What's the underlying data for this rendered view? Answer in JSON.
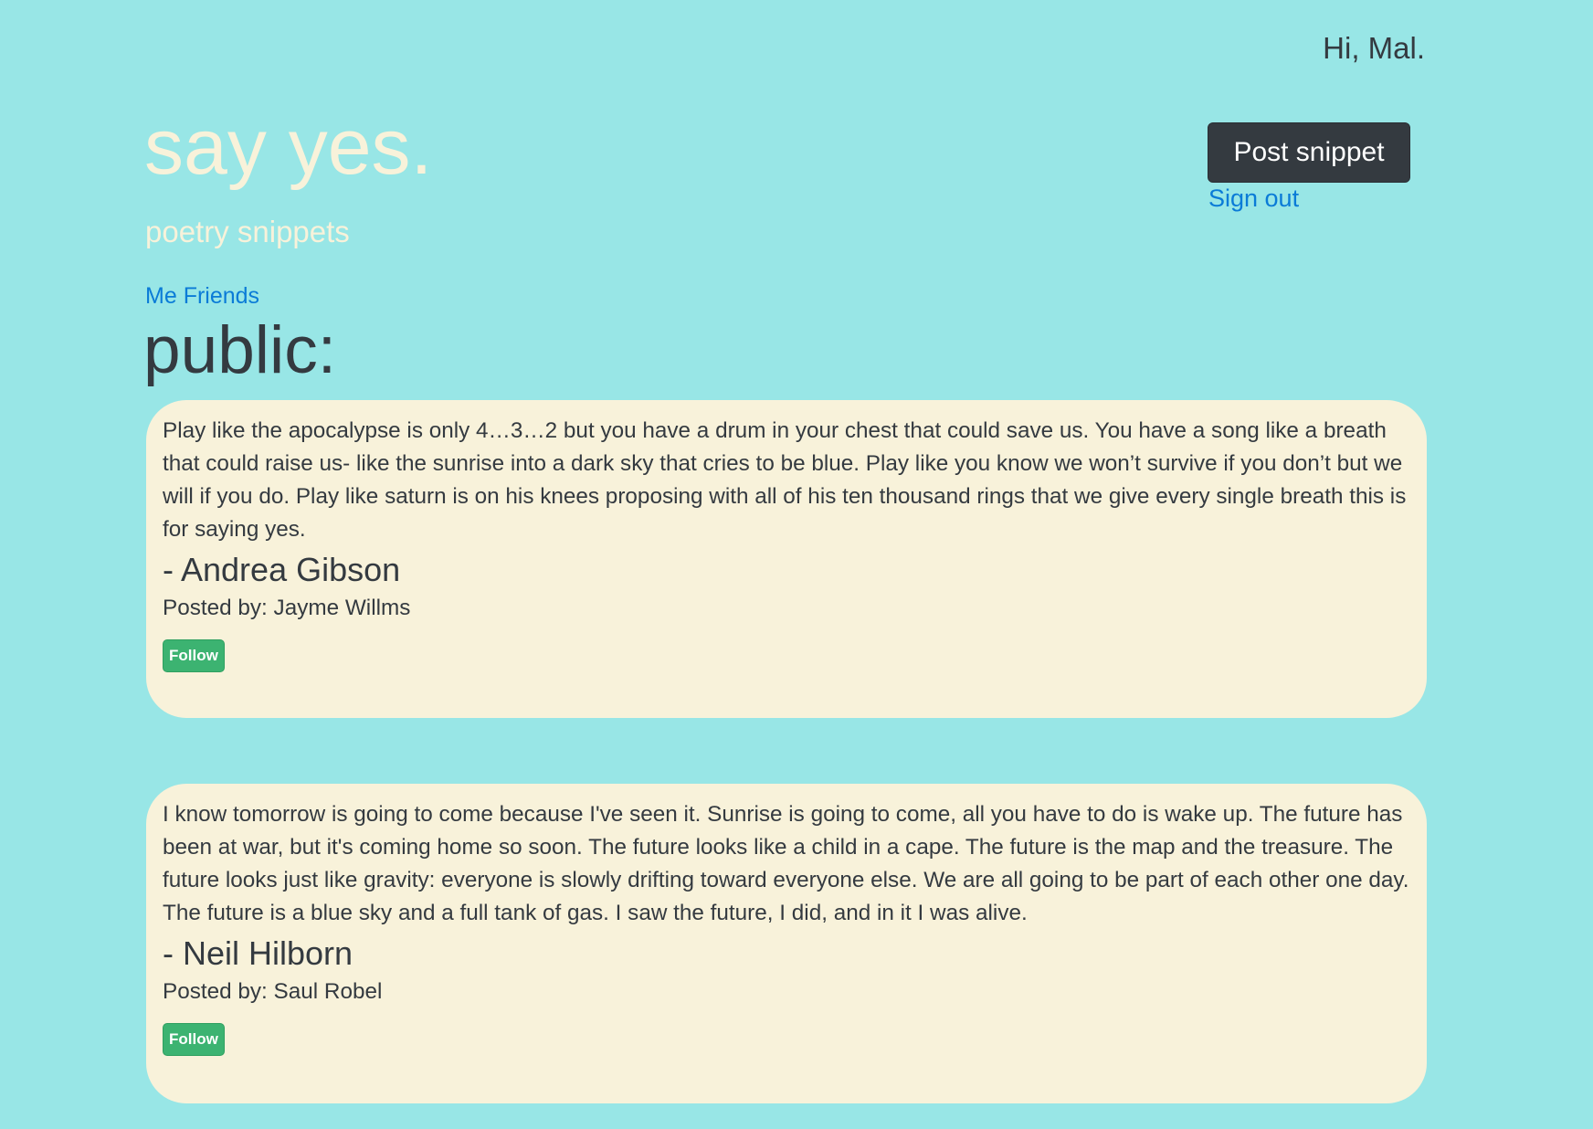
{
  "header": {
    "greeting": "Hi, Mal.",
    "title": "say yes.",
    "subtitle": "poetry snippets",
    "post_button": "Post snippet",
    "sign_out": "Sign out"
  },
  "nav": {
    "me": "Me",
    "friends": "Friends"
  },
  "section": {
    "heading": "public:"
  },
  "snippets": [
    {
      "text": "Play like the apocalypse is only 4…3…2 but you have a drum in your chest that could save us. You have a song like a breath that could raise us- like the sunrise into a dark sky that cries to be blue. Play like you know we won’t survive if you don’t but we will if you do. Play like saturn is on his knees proposing with all of his ten thousand rings that we give every single breath this is for saying yes.",
      "author": "- Andrea Gibson",
      "posted_by": "Posted by: Jayme Willms",
      "follow_label": "Follow"
    },
    {
      "text": "I know tomorrow is going to come because I've seen it. Sunrise is going to come, all you have to do is wake up. The future has been at war, but it's coming home so soon. The future looks like a child in a cape. The future is the map and the treasure. The future looks just like gravity: everyone is slowly drifting toward everyone else. We are all going to be part of each other one day. The future is a blue sky and a full tank of gas. I saw the future, I did, and in it I was alive.",
      "author": "- Neil Hilborn",
      "posted_by": "Posted by: Saul Robel",
      "follow_label": "Follow"
    }
  ],
  "colors": {
    "background": "#98e6e6",
    "cream": "#f8f2da",
    "link": "#0a7bd7",
    "dark_button": "#343a40",
    "follow_green": "#3cb371"
  }
}
